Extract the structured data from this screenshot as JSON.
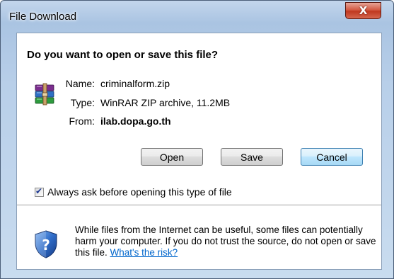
{
  "window": {
    "title": "File Download",
    "close_glyph": "X"
  },
  "dialog": {
    "question": "Do you want to open or save this file?",
    "file_icon": "winrar-archive-icon",
    "info": {
      "name_label": "Name:",
      "name_value": "criminalform.zip",
      "type_label": "Type:",
      "type_value": "WinRAR ZIP archive, 11.2MB",
      "from_label": "From:",
      "from_value": "ilab.dopa.go.th"
    },
    "buttons": {
      "open": "Open",
      "save": "Save",
      "cancel": "Cancel"
    },
    "always_ask": {
      "label": "Always ask before opening this type of file",
      "checked": true
    },
    "warning": {
      "icon": "security-shield-icon",
      "text": "While files from the Internet can be useful, some files can potentially harm your computer. If you do not trust the source, do not open or save this file.",
      "link": "What's the risk?"
    }
  },
  "colors": {
    "frame": "#b8cfe9",
    "close_button": "#c0381f",
    "link": "#0066cc",
    "default_button_border": "#3c7fb1"
  }
}
